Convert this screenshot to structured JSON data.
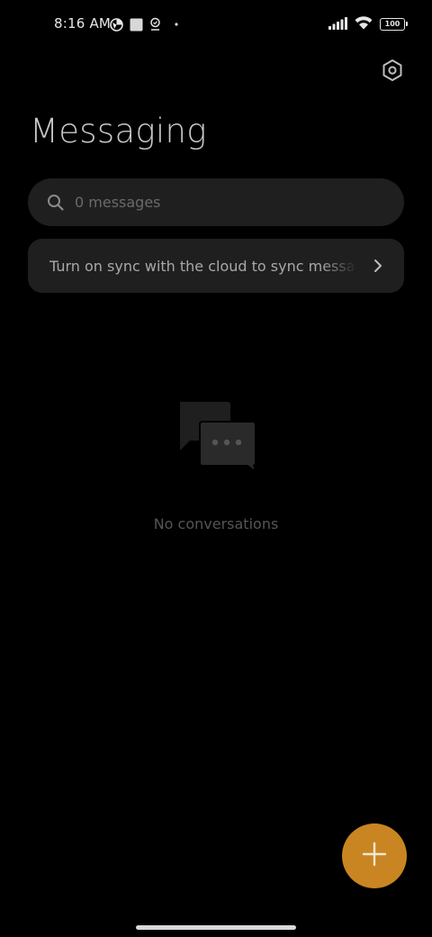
{
  "status_bar": {
    "time": "8:16 AM",
    "battery": "100",
    "left_icons": [
      "browser-icon",
      "image-icon",
      "location-icon",
      "notification-dot-icon"
    ],
    "right_icons": [
      "signal-icon",
      "wifi-icon",
      "battery-icon"
    ]
  },
  "header": {
    "title": "Messaging",
    "settings_icon": "settings-hexagon-icon"
  },
  "search": {
    "placeholder": "0 messages",
    "value": ""
  },
  "sync_banner": {
    "text": "Turn on sync with the cloud to sync messages"
  },
  "empty_state": {
    "icon": "chat-bubbles-icon",
    "text": "No conversations"
  },
  "fab": {
    "icon": "plus-icon"
  },
  "colors": {
    "background": "#000000",
    "surface": "#1f1f1f",
    "accent": "#c98522",
    "title": "#c8c8c8",
    "muted_text": "#555555"
  }
}
